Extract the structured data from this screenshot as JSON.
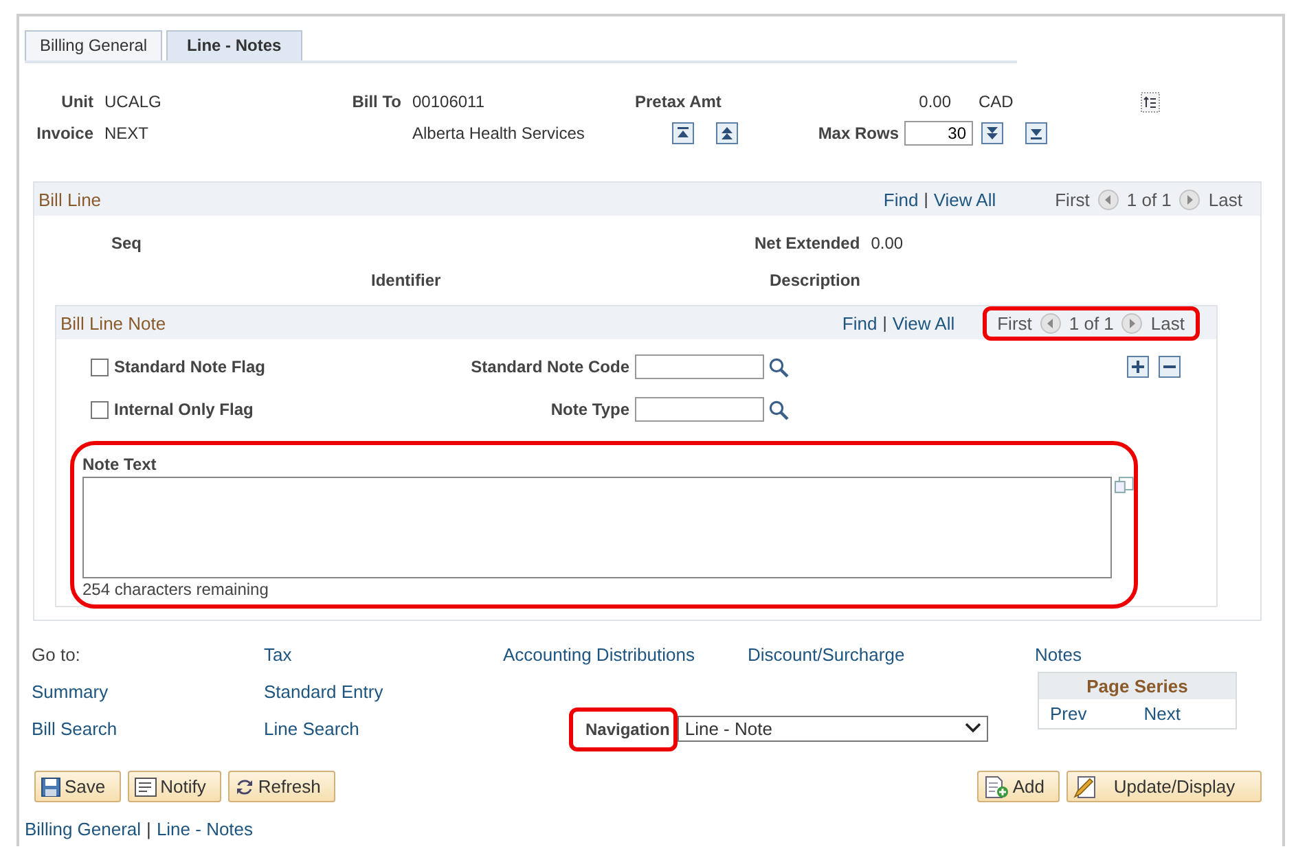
{
  "tabs": [
    {
      "label": "Billing General",
      "selected": false
    },
    {
      "label": "Line - Notes",
      "selected": true
    }
  ],
  "header": {
    "unit_label": "Unit",
    "unit": "UCALG",
    "invoice_label": "Invoice",
    "invoice": "NEXT",
    "bill_to_label": "Bill To",
    "bill_to": "00106011",
    "customer": "Alberta Health Services",
    "pretax_label": "Pretax Amt",
    "pretax_amount": "0.00",
    "currency": "CAD",
    "max_rows_label": "Max Rows",
    "max_rows": "30"
  },
  "bill_line": {
    "title": "Bill Line",
    "find": "Find",
    "separator": "|",
    "view_all": "View All",
    "first": "First",
    "counter": "1 of 1",
    "last": "Last",
    "seq_label": "Seq",
    "net_extended_label": "Net Extended",
    "net_extended": "0.00",
    "identifier_label": "Identifier",
    "description_label": "Description"
  },
  "bill_line_note": {
    "title": "Bill Line Note",
    "find": "Find",
    "separator": "|",
    "view_all": "View All",
    "first": "First",
    "counter": "1 of 1",
    "last": "Last",
    "highlighted": true,
    "flags": [
      {
        "label": "Standard Note Flag",
        "checked": false
      },
      {
        "label": "Internal Only Flag",
        "checked": false
      }
    ],
    "fields": [
      {
        "label": "Standard Note Code"
      },
      {
        "label": "Note Type"
      }
    ],
    "note_text_label": "Note Text",
    "remaining": "254 characters remaining",
    "note_highlighted": true
  },
  "goto": {
    "label": "Go to:",
    "columns": [
      [
        "Summary",
        "Bill Search"
      ],
      [
        "Tax",
        "Standard Entry",
        "Line Search"
      ],
      [
        "Accounting Distributions"
      ],
      [
        "Discount/Surcharge"
      ],
      [
        "Notes"
      ]
    ]
  },
  "navigation": {
    "label": "Navigation",
    "value": "Line - Note",
    "highlighted": true
  },
  "page_series": {
    "title": "Page Series",
    "prev": "Prev",
    "next": "Next"
  },
  "buttons_left": [
    {
      "label": "Save",
      "kind": "save"
    },
    {
      "label": "Notify",
      "kind": "notify"
    },
    {
      "label": "Refresh",
      "kind": "refresh"
    }
  ],
  "buttons_right": [
    {
      "label": "Add",
      "kind": "add"
    },
    {
      "label": "Update/Display",
      "kind": "update"
    }
  ],
  "footer": {
    "links": [
      "Billing General",
      "Line - Notes"
    ],
    "separator": "|"
  }
}
